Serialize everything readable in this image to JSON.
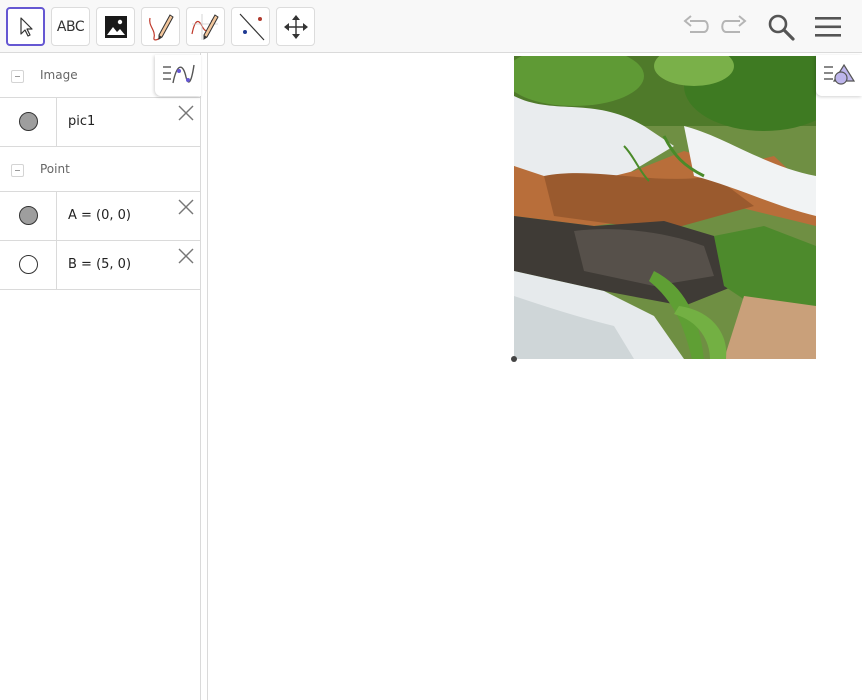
{
  "toolbar": {
    "tools": [
      {
        "name": "Move",
        "icon": "move-arrow-icon",
        "selected": true
      },
      {
        "name": "Text",
        "label": "ABC",
        "icon": "text-icon"
      },
      {
        "name": "Image",
        "icon": "image-icon"
      },
      {
        "name": "Pen",
        "icon": "pen-icon"
      },
      {
        "name": "Freehand Function",
        "icon": "freehand-function-icon"
      },
      {
        "name": "Point",
        "icon": "point-line-icon"
      },
      {
        "name": "Move Graphics View",
        "icon": "move-graphics-icon"
      }
    ],
    "undo_icon": "undo-icon",
    "redo_icon": "redo-icon",
    "search_icon": "search-icon",
    "menu_icon": "hamburger-menu-icon"
  },
  "algebra": {
    "groups": [
      {
        "label": "Image",
        "items": [
          {
            "text": "pic1",
            "marble": "filled"
          }
        ]
      },
      {
        "label": "Point",
        "items": [
          {
            "text": "A = (0, 0)",
            "marble": "filled"
          },
          {
            "text": "B = (5, 0)",
            "marble": "empty"
          }
        ]
      }
    ]
  },
  "graphics": {
    "image_label": "waterfall photo"
  },
  "colors": {
    "accent": "#6557d2",
    "toolbar_bg": "#f8f8f8",
    "divider": "#dadada",
    "marble_fill": "#9e9e9e"
  }
}
